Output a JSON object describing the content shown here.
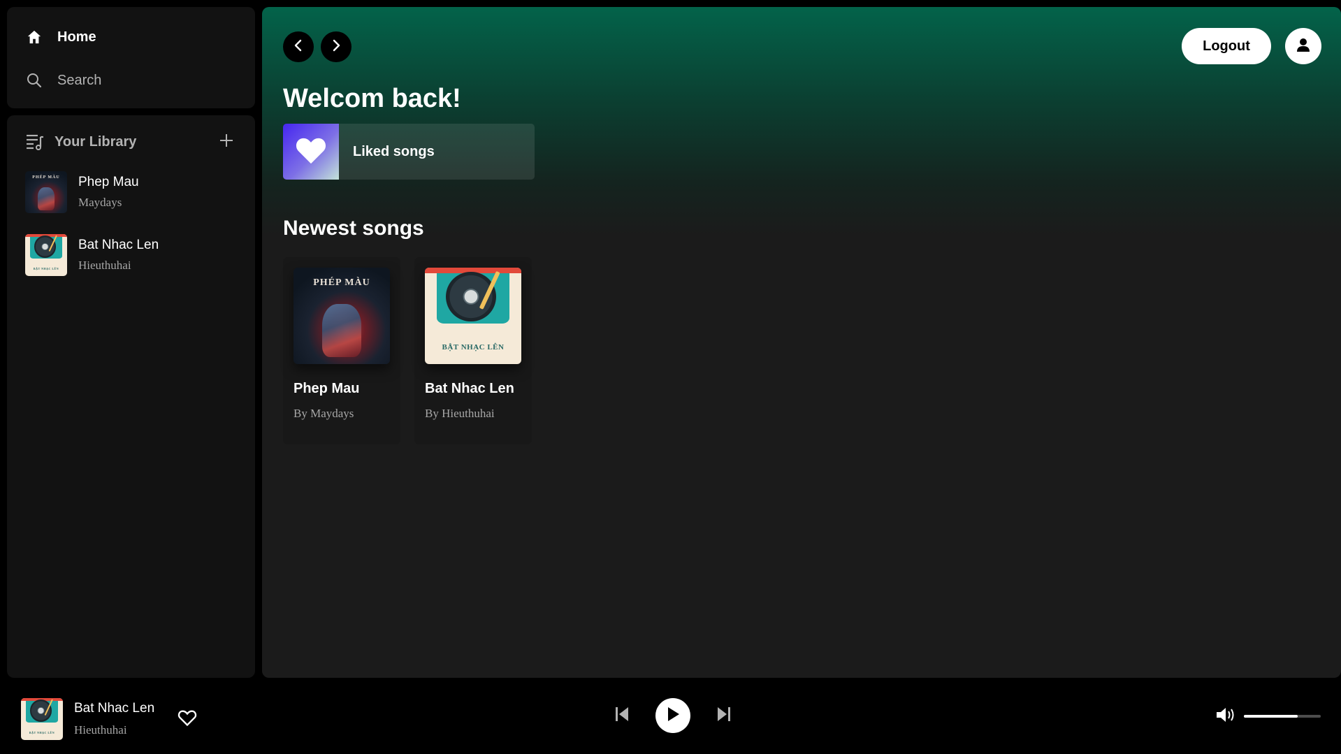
{
  "sidebar": {
    "nav": {
      "home_label": "Home",
      "search_label": "Search"
    },
    "library": {
      "title": "Your Library",
      "items": [
        {
          "title": "Phep Mau",
          "subtitle": "Maydays",
          "cover_text": "PHÉP MÀU"
        },
        {
          "title": "Bat Nhac Len",
          "subtitle": "Hieuthuhai",
          "cover_text": "BẬT NHẠC LÊN"
        }
      ]
    }
  },
  "main": {
    "header": {
      "logout_label": "Logout"
    },
    "welcome": "Welcom back!",
    "liked_songs_label": "Liked songs",
    "newest": {
      "title": "Newest songs",
      "songs": [
        {
          "title": "Phep Mau",
          "subtitle": "By Maydays",
          "cover_text": "PHÉP MÀU"
        },
        {
          "title": "Bat Nhac Len",
          "subtitle": "By Hieuthuhai",
          "cover_text": "BẬT NHẠC LÊN"
        }
      ]
    }
  },
  "player": {
    "now_playing": {
      "title": "Bat Nhac Len",
      "subtitle": "Hieuthuhai",
      "cover_text": "BẬT NHẠC LÊN"
    },
    "volume_level": 0.7
  },
  "colors": {
    "accent_green": "#03634a",
    "panel": "#121212",
    "card": "#181818",
    "muted_text": "#a7a7a7"
  },
  "icons": {
    "home": "home-icon",
    "search": "search-icon",
    "library": "library-icon",
    "add": "plus-icon",
    "back": "chevron-left-icon",
    "forward": "chevron-right-icon",
    "profile": "user-icon",
    "heart": "heart-icon",
    "previous": "skip-back-icon",
    "play": "play-icon",
    "next": "skip-forward-icon",
    "volume": "volume-icon"
  }
}
